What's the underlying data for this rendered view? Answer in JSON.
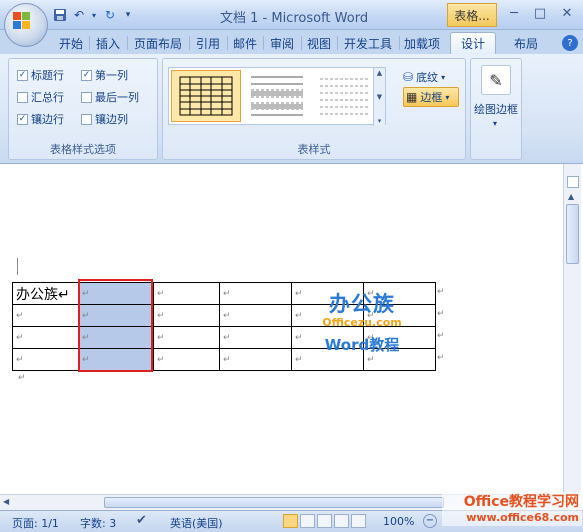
{
  "title_bar": {
    "doc_title": "文档 1 - Microsoft Word",
    "context_title": "表格...",
    "qat_items": [
      "save-icon",
      "undo-icon",
      "redo-icon",
      "customize-icon"
    ],
    "qat_glyphs": [
      "▾",
      "▾"
    ]
  },
  "tabs": [
    "开始",
    "插入",
    "页面布局",
    "引用",
    "邮件",
    "审阅",
    "视图",
    "开发工具",
    "加载项",
    "设计",
    "布局"
  ],
  "ribbon": {
    "table_style_options": {
      "label": "表格样式选项",
      "checkboxes": [
        {
          "label": "标题行",
          "checked": true
        },
        {
          "label": "第一列",
          "checked": true
        },
        {
          "label": "汇总行",
          "checked": false
        },
        {
          "label": "最后一列",
          "checked": false
        },
        {
          "label": "镶边行",
          "checked": true
        },
        {
          "label": "镶边列",
          "checked": false
        }
      ]
    },
    "table_styles": {
      "label": "表样式",
      "shading_label": "底纹",
      "borders_label": "边框"
    },
    "draw_borders": {
      "label": "绘图边框"
    }
  },
  "document": {
    "table": [
      [
        "办公族↵",
        "↵",
        "↵",
        "↵",
        "↵",
        "↵"
      ],
      [
        "↵",
        "↵",
        "↵",
        "↵",
        "↵",
        "↵"
      ],
      [
        "↵",
        "↵",
        "↵",
        "↵",
        "↵",
        "↵"
      ],
      [
        "↵",
        "↵",
        "↵",
        "↵",
        "↵",
        "↵"
      ]
    ],
    "row_end_mark": "↵",
    "after_table_mark": "↵"
  },
  "watermark": {
    "logo_text": "办公族",
    "site": "Officezu.com",
    "tagline": "Word教程"
  },
  "status_bar": {
    "page": "页面: 1/1",
    "words": "字数: 3",
    "language": "英语(美国)",
    "zoom": "100%",
    "corner_watermark": "Office教程学习网",
    "corner_url": "www.office68.com"
  }
}
